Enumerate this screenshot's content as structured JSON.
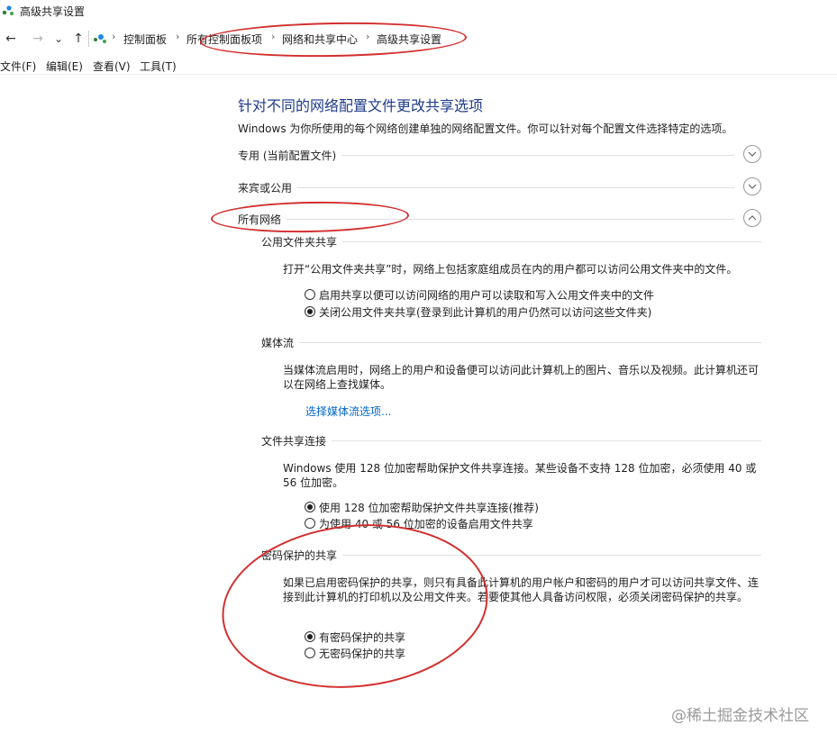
{
  "window": {
    "title": "高级共享设置",
    "icon": "network-icon"
  },
  "navigation": {
    "back_icon": "←",
    "forward_icon": "→",
    "recent_icon": "⌄",
    "up_icon": "↑",
    "breadcrumb_separator": "›",
    "breadcrumbs": [
      "控制面板",
      "所有控制面板项",
      "网络和共享中心",
      "高级共享设置"
    ]
  },
  "menu": [
    "文件(F)",
    "编辑(E)",
    "查看(V)",
    "工具(T)"
  ],
  "content": {
    "heading": "针对不同的网络配置文件更改共享选项",
    "description": "Windows 为你所使用的每个网络创建单独的网络配置文件。你可以针对每个配置文件选择特定的选项。",
    "profiles": [
      {
        "label": "专用 (当前配置文件)",
        "state": "collapsed"
      },
      {
        "label": "来宾或公用",
        "state": "collapsed"
      },
      {
        "label": "所有网络",
        "state": "expanded"
      }
    ],
    "public_folder": {
      "title": "公用文件夹共享",
      "text": "打开“公用文件夹共享”时，网络上包括家庭组成员在内的用户都可以访问公用文件夹中的文件。",
      "options": [
        {
          "label": "启用共享以便可以访问网络的用户可以读取和写入公用文件夹中的文件",
          "checked": false
        },
        {
          "label": "关闭公用文件夹共享(登录到此计算机的用户仍然可以访问这些文件夹)",
          "checked": true
        }
      ]
    },
    "media_streaming": {
      "title": "媒体流",
      "text": "当媒体流启用时，网络上的用户和设备便可以访问此计算机上的图片、音乐以及视频。此计算机还可以在网络上查找媒体。",
      "link": "选择媒体流选项..."
    },
    "file_sharing": {
      "title": "文件共享连接",
      "text": "Windows 使用 128 位加密帮助保护文件共享连接。某些设备不支持 128 位加密，必须使用 40 或 56 位加密。",
      "options": [
        {
          "label": "使用 128 位加密帮助保护文件共享连接(推荐)",
          "checked": true
        },
        {
          "label": "为使用 40 或 56 位加密的设备启用文件共享",
          "checked": false
        }
      ]
    },
    "password_protected": {
      "title": "密码保护的共享",
      "text": "如果已启用密码保护的共享，则只有具备此计算机的用户帐户和密码的用户才可以访问共享文件、连接到此计算机的打印机以及公用文件夹。若要使其他人具备访问权限，必须关闭密码保护的共享。",
      "options": [
        {
          "label": "有密码保护的共享",
          "checked": true
        },
        {
          "label": "无密码保护的共享",
          "checked": false
        }
      ]
    }
  },
  "watermark": "@稀土掘金技术社区",
  "colors": {
    "annotation": "#d32f2f",
    "link": "#0066cc",
    "heading": "#1e3a8a"
  }
}
